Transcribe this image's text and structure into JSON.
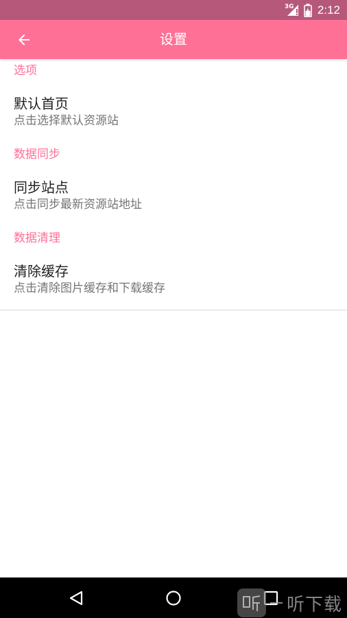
{
  "status_bar": {
    "network": "3G",
    "time": "2:12"
  },
  "app_bar": {
    "title": "设置"
  },
  "sections": [
    {
      "header": "选项",
      "items": [
        {
          "title": "默认首页",
          "summary": "点击选择默认资源站"
        }
      ]
    },
    {
      "header": "数据同步",
      "items": [
        {
          "title": "同步站点",
          "summary": "点击同步最新资源站地址"
        }
      ]
    },
    {
      "header": "数据清理",
      "items": [
        {
          "title": "清除缓存",
          "summary": "点击清除图片缓存和下载缓存"
        }
      ]
    }
  ],
  "watermark": {
    "badge_char": "听",
    "text": "听下载"
  },
  "colors": {
    "status_bar": "#b5587a",
    "app_bar": "#ff7096",
    "accent": "#ff6f97",
    "nav_bar": "#000000"
  },
  "icons": {
    "back": "arrow-left-icon",
    "signal": "signal-icon",
    "battery": "battery-icon",
    "nav_back": "triangle-back-icon",
    "nav_home": "circle-home-icon",
    "nav_recent": "square-recent-icon"
  }
}
